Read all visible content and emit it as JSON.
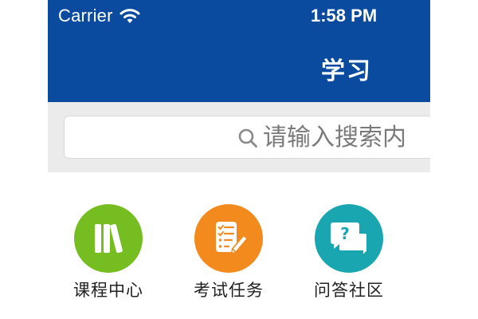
{
  "status_bar": {
    "carrier": "Carrier",
    "time": "1:58 PM",
    "icons": [
      "wifi-icon"
    ]
  },
  "nav": {
    "title": "学习"
  },
  "search": {
    "placeholder": "请输入搜索内",
    "icon": "search-icon"
  },
  "shortcuts": [
    {
      "label": "课程中心",
      "icon": "books-icon",
      "color": "#76bd22"
    },
    {
      "label": "考试任务",
      "icon": "exam-checklist-icon",
      "color": "#f28a1e"
    },
    {
      "label": "问答社区",
      "icon": "qa-chat-icon",
      "color": "#1aa6b1"
    }
  ],
  "colors": {
    "header": "#0a4b9f",
    "search_band": "#ebebeb"
  }
}
